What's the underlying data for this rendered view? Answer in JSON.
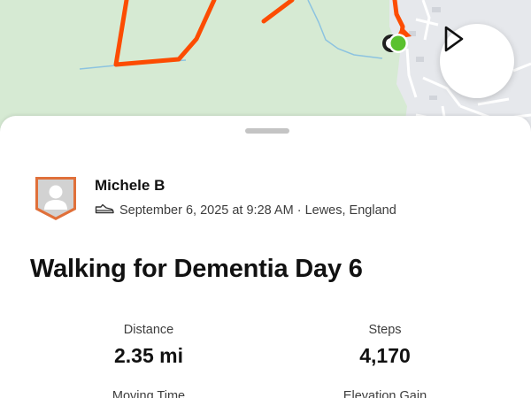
{
  "colors": {
    "route": "#fc4c02",
    "map_background": "#d6ead3",
    "start_marker": "#5ac12e",
    "water": "#8cc3e0"
  },
  "map": {
    "play_icon": "play-icon"
  },
  "activity": {
    "athlete_name": "Michele B",
    "sport_icon": "shoe-icon",
    "date_location": "September 6, 2025 at 9:28 AM · Lewes, England",
    "title": "Walking for Dementia Day 6"
  },
  "stats": [
    {
      "label": "Distance",
      "value": "2.35 mi"
    },
    {
      "label": "Steps",
      "value": "4,170"
    },
    {
      "label": "Moving Time",
      "value": ""
    },
    {
      "label": "Elevation Gain",
      "value": ""
    }
  ]
}
